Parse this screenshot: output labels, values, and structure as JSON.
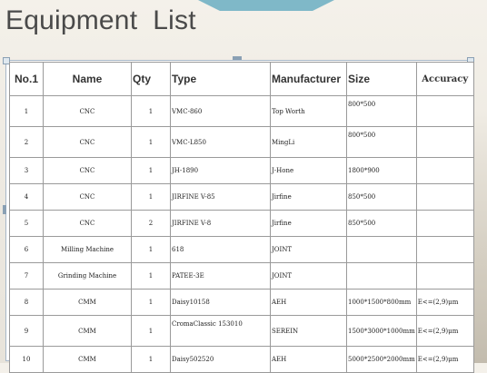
{
  "page": {
    "title": "Equipment  List"
  },
  "table": {
    "headers": [
      "No.1",
      "Name",
      "Qty",
      "Type",
      "Manufacturer",
      "Size",
      "Accuracy"
    ],
    "rows": [
      [
        "1",
        "CNC",
        "1",
        "VMC-860",
        "Top Worth",
        "800*500",
        ""
      ],
      [
        "2",
        "CNC",
        "1",
        "VMC-L850",
        "MingLi",
        "800*500",
        ""
      ],
      [
        "3",
        "CNC",
        "1",
        "JH-1890",
        "J-Hone",
        "1800*900",
        ""
      ],
      [
        "4",
        "CNC",
        "1",
        "JIRFINE V-85",
        "Jirfine",
        "850*500",
        ""
      ],
      [
        "5",
        "CNC",
        "2",
        "JIRFINE V-8",
        "Jirfine",
        "850*500",
        ""
      ],
      [
        "6",
        "Milling Machine",
        "1",
        "618",
        "JOINT",
        "",
        ""
      ],
      [
        "7",
        "Grinding  Machine",
        "1",
        "PATEE-3E",
        "JOINT",
        "",
        ""
      ],
      [
        "8",
        "CMM",
        "1",
        "Daisy10158",
        "AEH",
        "1000*1500*800mm",
        "E<=(2,9)μm"
      ],
      [
        "9",
        "CMM",
        "1",
        "CromaClassic 153010",
        "SEREIN",
        "1500*3000*1000mm",
        "E<=(2,9)μm"
      ],
      [
        "10",
        "CMM",
        "1",
        "Daisy502520",
        "AEH",
        "5000*2500*2000mm",
        "E<=(2,9)μm"
      ]
    ]
  },
  "colors": {
    "accent": "#7fb8c8",
    "frame": "#a8b8c8",
    "title": "#4a4a4a"
  }
}
